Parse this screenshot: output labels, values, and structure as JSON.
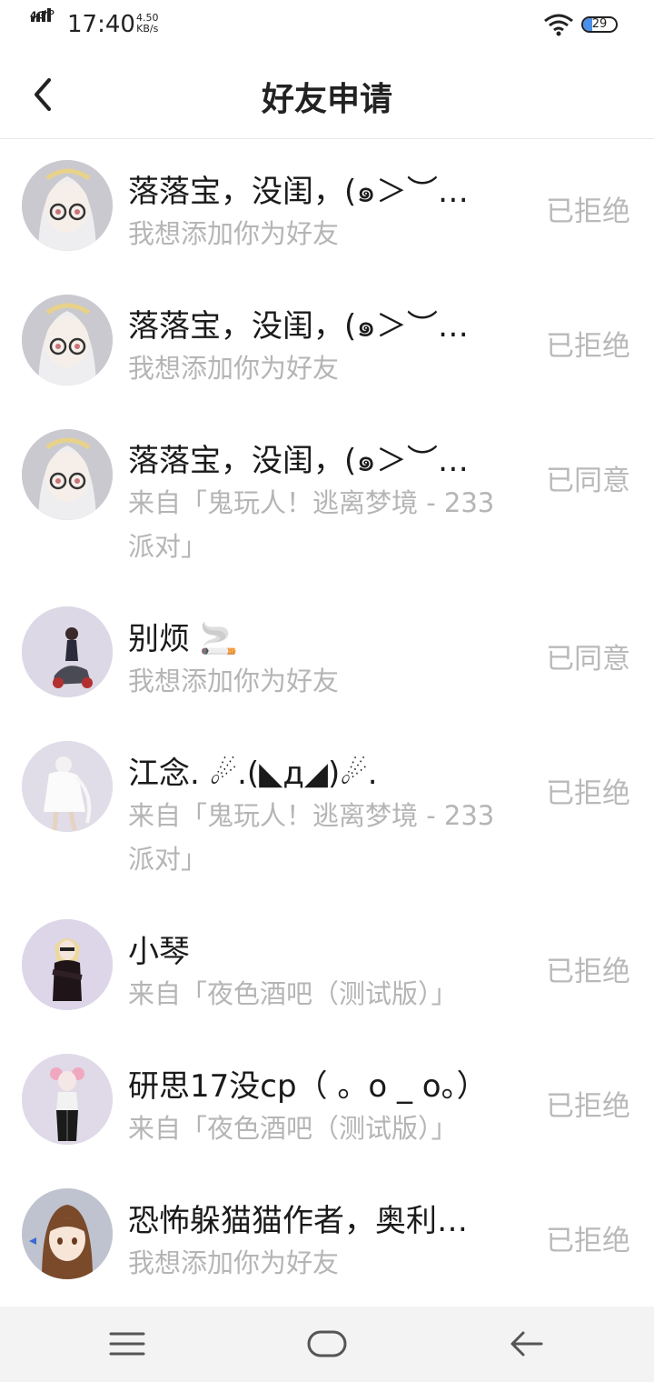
{
  "status_bar": {
    "network": "4G",
    "network_sup": "HD",
    "time": "17:40",
    "speed_value": "4.50",
    "speed_unit": "KB/s",
    "battery": "29"
  },
  "header": {
    "title": "好友申请",
    "back_icon": "chevron-left-icon"
  },
  "requests": [
    {
      "name": "落落宝，没闺，(๑＞︶…",
      "message": "我想添加你为好友",
      "status": "已拒绝",
      "avatar": "white-hair-glasses-girl"
    },
    {
      "name": "落落宝，没闺，(๑＞︶…",
      "message": "我想添加你为好友",
      "status": "已拒绝",
      "avatar": "white-hair-glasses-girl"
    },
    {
      "name": "落落宝，没闺，(๑＞︶…",
      "message": "来自「鬼玩人！逃离梦境 - 233派对」",
      "status": "已同意",
      "avatar": "white-hair-glasses-girl"
    },
    {
      "name": "别烦 🚬",
      "message": "我想添加你为好友",
      "status": "已同意",
      "avatar": "boy-on-motorbike"
    },
    {
      "name": "江念. ☄.(◣д◢)☄.",
      "message": "来自「鬼玩人！逃离梦境 - 233派对」",
      "status": "已拒绝",
      "avatar": "white-dress-girl"
    },
    {
      "name": "小琴",
      "message": "来自「夜色酒吧（测试版）」",
      "status": "已拒绝",
      "avatar": "blonde-black-outfit-girl"
    },
    {
      "name": "研思17没cp（ 。o _ o。）",
      "message": "来自「夜色酒吧（测试版）」",
      "status": "已拒绝",
      "avatar": "pink-hair-girl"
    },
    {
      "name": "恐怖躲猫猫作者，奥利…",
      "message": "我想添加你为好友",
      "status": "已拒绝",
      "avatar": "brown-hair-girl"
    }
  ],
  "nav_bar": {
    "menu_icon": "menu-icon",
    "home_icon": "home-icon",
    "back_icon": "back-arrow-icon"
  },
  "colors": {
    "status_text": "#b9b9b9",
    "sub_text": "#b5b5b5",
    "battery_fill": "#4a8fe8"
  }
}
